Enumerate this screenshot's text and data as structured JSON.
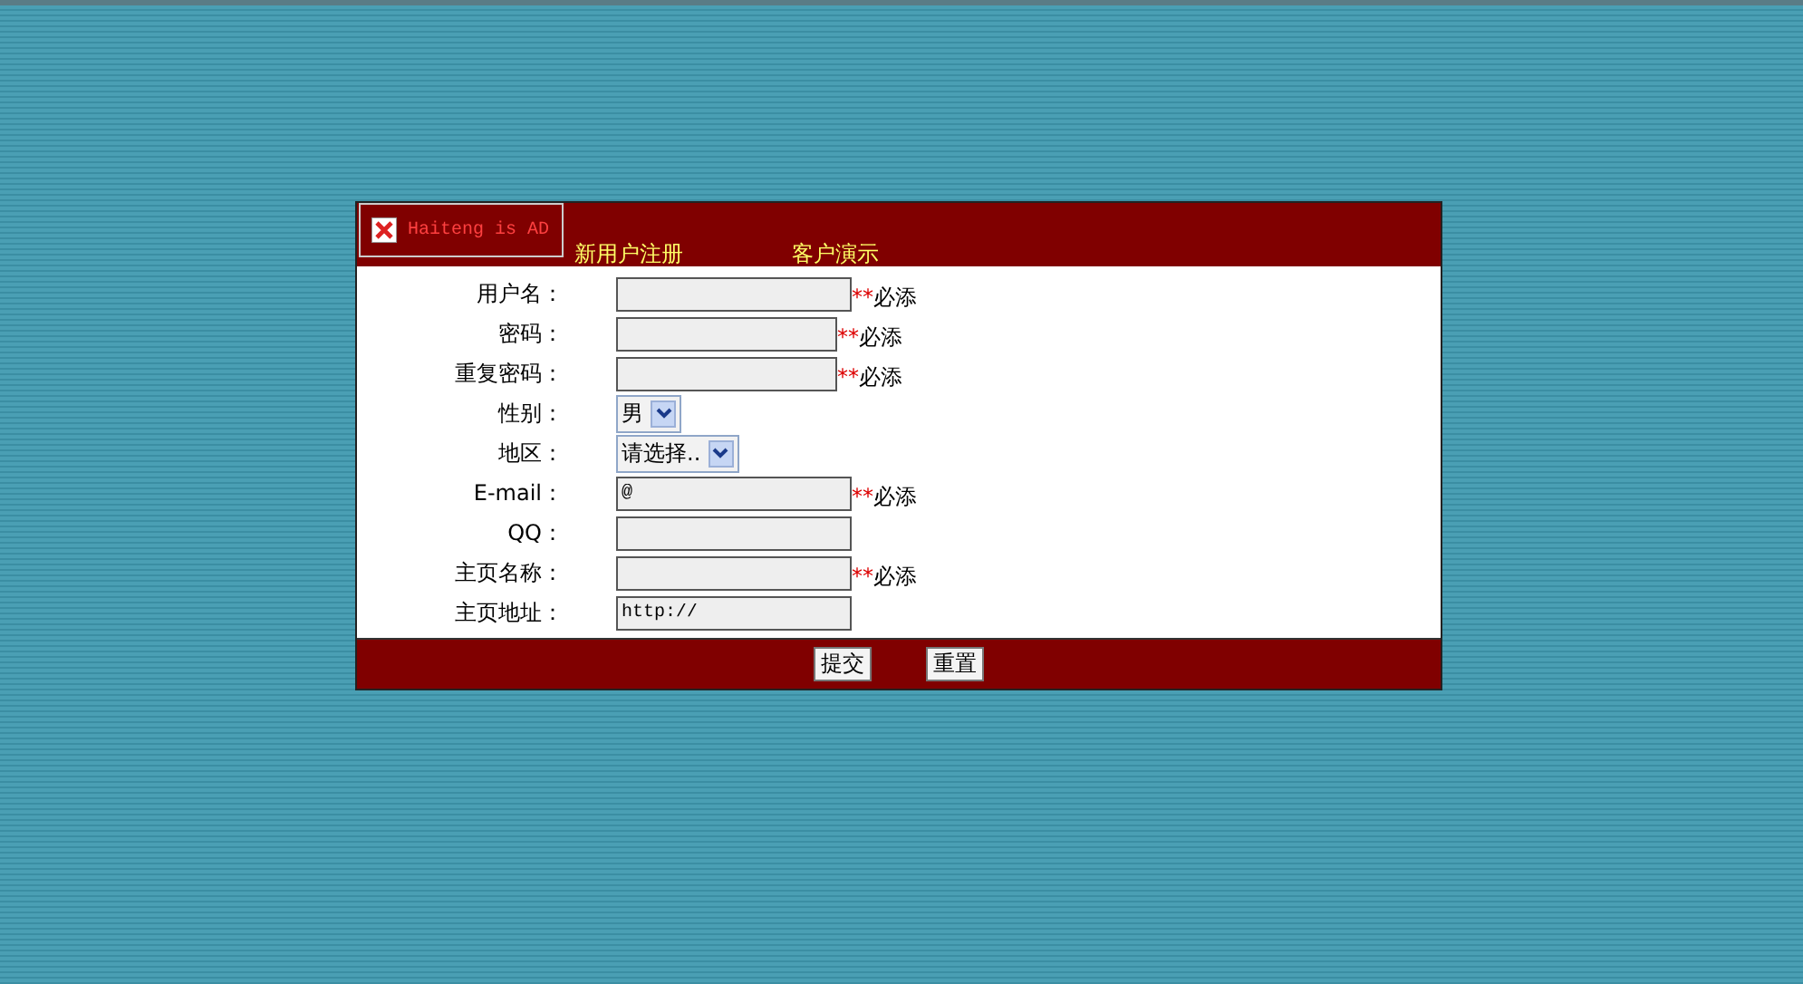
{
  "ad": {
    "text": "Haiteng is AD"
  },
  "header_links": [
    {
      "label": "新用户注册"
    },
    {
      "label": "客户演示"
    }
  ],
  "fields": [
    {
      "label": "用户名：",
      "kind": "text",
      "note": "**必添",
      "wide": true
    },
    {
      "label": "密码：",
      "kind": "text",
      "note": "**必添",
      "wide": false
    },
    {
      "label": "重复密码：",
      "kind": "text",
      "note": "**必添",
      "wide": false
    },
    {
      "label": "性别：",
      "kind": "select",
      "value": "男"
    },
    {
      "label": "地区：",
      "kind": "select",
      "value": "请选择.."
    },
    {
      "label": "E-mail：",
      "kind": "text",
      "value": "@",
      "note": "**必添",
      "wide": true
    },
    {
      "label": "QQ：",
      "kind": "text",
      "wide": true
    },
    {
      "label": "主页名称：",
      "kind": "text",
      "note": "**必添",
      "wide": true
    },
    {
      "label": "主页地址：",
      "kind": "text",
      "value": "http://",
      "wide": true
    }
  ],
  "buttons": [
    {
      "label": "提交"
    },
    {
      "label": "重置"
    }
  ]
}
